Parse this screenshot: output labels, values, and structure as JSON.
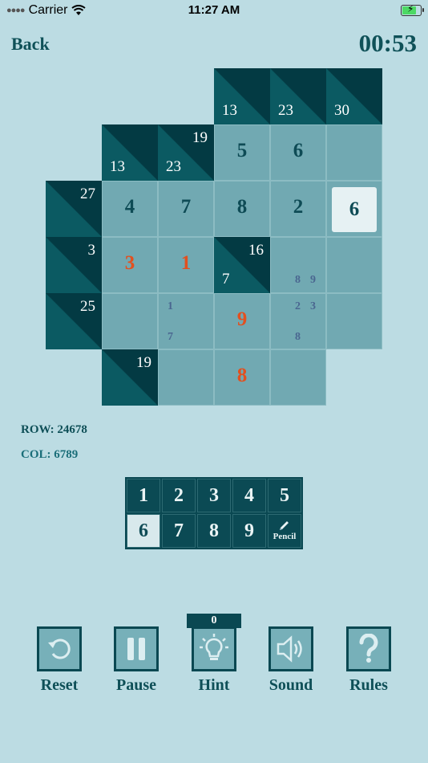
{
  "status_bar": {
    "carrier": "Carrier",
    "time": "11:27 AM"
  },
  "header": {
    "back_label": "Back",
    "timer": "00:53"
  },
  "board": {
    "clues": [
      {
        "id": "c1",
        "bottom": "13"
      },
      {
        "id": "c2",
        "bottom": "23"
      },
      {
        "id": "c3",
        "bottom": "30"
      },
      {
        "id": "c4",
        "bottom": "13"
      },
      {
        "id": "c5",
        "top": "19",
        "bottom": "23"
      },
      {
        "id": "c6",
        "top": "27"
      },
      {
        "id": "c7",
        "top": "3"
      },
      {
        "id": "c8",
        "top": "16",
        "bottom": "7"
      },
      {
        "id": "c9",
        "top": "25"
      },
      {
        "id": "c10",
        "top": "19"
      }
    ],
    "values": {
      "r1c3": "5",
      "r1c4": "6",
      "r2c1": "4",
      "r2c2": "7",
      "r2c3": "8",
      "r2c4": "2",
      "r2c5": "6",
      "r3c1": "3",
      "r3c2": "1",
      "r4c3": "9",
      "r5c3": "8"
    },
    "pencil": {
      "r3c4_a": "8",
      "r3c4_b": "9",
      "r4c2_a": "1",
      "r4c2_b": "7",
      "r4c4_a": "2",
      "r4c4_b": "3",
      "r4c4_c": "8"
    }
  },
  "info": {
    "row": "ROW: 24678",
    "col": "COL: 6789"
  },
  "keypad": {
    "keys": [
      "1",
      "2",
      "3",
      "4",
      "5",
      "6",
      "7",
      "8",
      "9"
    ],
    "pencil_label": "Pencil",
    "selected": "6"
  },
  "controls": {
    "reset": "Reset",
    "pause": "Pause",
    "hint": "Hint",
    "sound": "Sound",
    "rules": "Rules",
    "hint_count": "0"
  },
  "colors": {
    "background": "#bcdce3",
    "clue": "#05444d",
    "cell": "#71a9b2",
    "error": "#e2501f",
    "pencil": "#4a6690"
  }
}
